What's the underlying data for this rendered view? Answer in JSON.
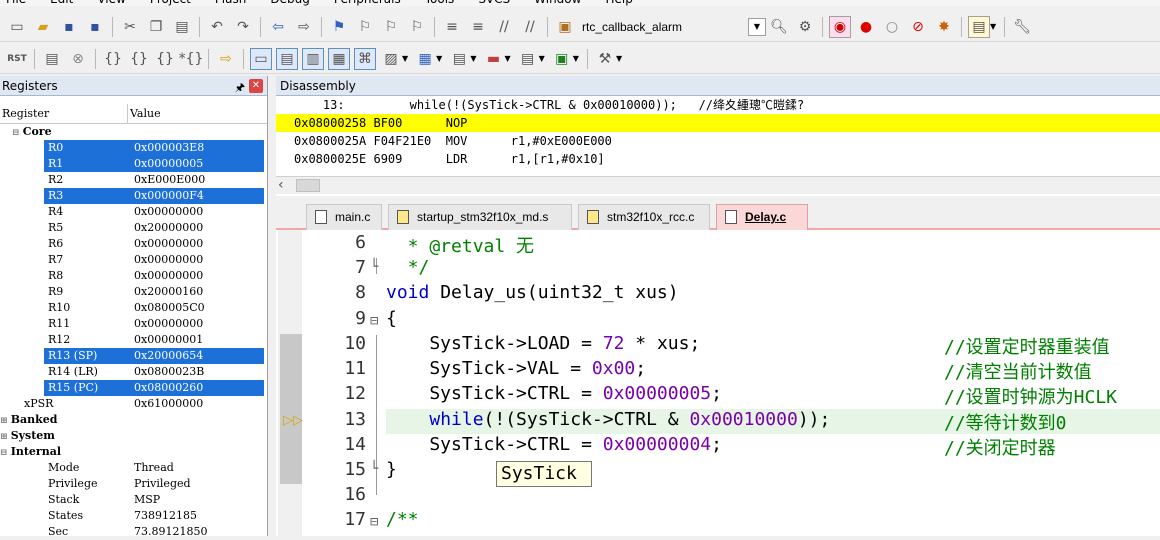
{
  "menu": [
    "File",
    "Edit",
    "View",
    "Project",
    "Flash",
    "Debug",
    "Peripherals",
    "Tools",
    "SVCS",
    "Window",
    "Help"
  ],
  "toolbar": {
    "target_value": "rtc_callback_alarm"
  },
  "registers": {
    "panel_title": "Registers",
    "col_register": "Register",
    "col_value": "Value",
    "core_label": "Core",
    "rows": [
      {
        "name": "R0",
        "value": "0x000003E8",
        "selected": true
      },
      {
        "name": "R1",
        "value": "0x00000005",
        "selected": true
      },
      {
        "name": "R2",
        "value": "0xE000E000",
        "selected": false
      },
      {
        "name": "R3",
        "value": "0x000000F4",
        "selected": true
      },
      {
        "name": "R4",
        "value": "0x00000000",
        "selected": false
      },
      {
        "name": "R5",
        "value": "0x20000000",
        "selected": false
      },
      {
        "name": "R6",
        "value": "0x00000000",
        "selected": false
      },
      {
        "name": "R7",
        "value": "0x00000000",
        "selected": false
      },
      {
        "name": "R8",
        "value": "0x00000000",
        "selected": false
      },
      {
        "name": "R9",
        "value": "0x20000160",
        "selected": false
      },
      {
        "name": "R10",
        "value": "0x080005C0",
        "selected": false
      },
      {
        "name": "R11",
        "value": "0x00000000",
        "selected": false
      },
      {
        "name": "R12",
        "value": "0x00000001",
        "selected": false
      },
      {
        "name": "R13 (SP)",
        "value": "0x20000654",
        "selected": true
      },
      {
        "name": "R14 (LR)",
        "value": "0x0800023B",
        "selected": false
      },
      {
        "name": "R15 (PC)",
        "value": "0x08000260",
        "selected": true
      },
      {
        "name": "xPSR",
        "value": "0x61000000",
        "selected": false
      }
    ],
    "banked_label": "Banked",
    "system_label": "System",
    "internal_label": "Internal",
    "internal_rows": [
      {
        "name": "Mode",
        "value": "Thread"
      },
      {
        "name": "Privilege",
        "value": "Privileged"
      },
      {
        "name": "Stack",
        "value": "MSP"
      },
      {
        "name": "States",
        "value": "738912185"
      },
      {
        "name": "Sec",
        "value": "73.89121850"
      }
    ]
  },
  "disassembly": {
    "title": "Disassembly",
    "lines": [
      {
        "text": "    13:         while(!(SysTick->CTRL & 0x00010000));   //绛夊緟璁℃暟鍒?",
        "hl": false
      },
      {
        "text": "0x08000258 BF00      NOP",
        "hl": true
      },
      {
        "text": "0x0800025A F04F21E0  MOV      r1,#0xE000E000",
        "hl": false
      },
      {
        "text": "0x0800025E 6909      LDR      r1,[r1,#0x10]",
        "hl": false
      }
    ]
  },
  "tabs": [
    {
      "label": "main.c",
      "active": false
    },
    {
      "label": "startup_stm32f10x_md.s",
      "active": false
    },
    {
      "label": "stm32f10x_rcc.c",
      "active": false
    },
    {
      "label": "Delay.c",
      "active": true
    }
  ],
  "editor": {
    "lines": [
      {
        "no": "6",
        "code": "  * @retval 无"
      },
      {
        "no": "7",
        "code": "  */"
      },
      {
        "no": "8",
        "code": "void Delay_us(uint32_t xus)"
      },
      {
        "no": "9",
        "code": "{"
      },
      {
        "no": "10",
        "code": "    SysTick->LOAD = 72 * xus;",
        "comment": "//设置定时器重装值"
      },
      {
        "no": "11",
        "code": "    SysTick->VAL = 0x00;",
        "comment": "//清空当前计数值"
      },
      {
        "no": "12",
        "code": "    SysTick->CTRL = 0x00000005;",
        "comment": "//设置时钟源为HCLK"
      },
      {
        "no": "13",
        "code": "    while(!(SysTick->CTRL & 0x00010000));",
        "comment": "//等待计数到0"
      },
      {
        "no": "14",
        "code": "    SysTick->CTRL = 0x00000004;",
        "comment": "//关闭定时器"
      },
      {
        "no": "15",
        "code": "}"
      },
      {
        "no": "16",
        "code": ""
      },
      {
        "no": "17",
        "code": "/**"
      }
    ],
    "tooltip": "SysTick"
  }
}
